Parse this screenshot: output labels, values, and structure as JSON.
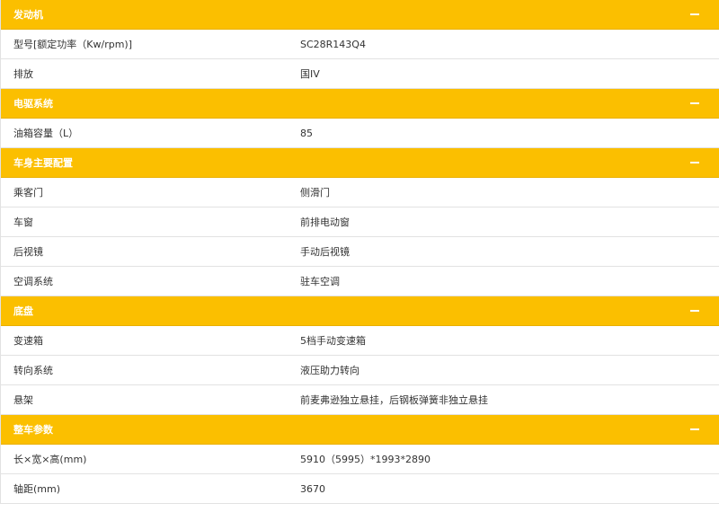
{
  "sections": [
    {
      "title": "发动机",
      "rows": [
        {
          "label": "型号[额定功率（Kw/rpm)]",
          "value": "SC28R143Q4"
        },
        {
          "label": "排放",
          "value": "国IV"
        }
      ]
    },
    {
      "title": "电驱系统",
      "rows": [
        {
          "label": "油箱容量（L）",
          "value": "85"
        }
      ]
    },
    {
      "title": "车身主要配置",
      "rows": [
        {
          "label": "乘客门",
          "value": "侧滑门"
        },
        {
          "label": "车窗",
          "value": "前排电动窗"
        },
        {
          "label": "后视镜",
          "value": "手动后视镜"
        },
        {
          "label": "空调系统",
          "value": "驻车空调"
        }
      ]
    },
    {
      "title": "底盘",
      "rows": [
        {
          "label": "变速箱",
          "value": "5档手动变速箱"
        },
        {
          "label": "转向系统",
          "value": "液压助力转向"
        },
        {
          "label": "悬架",
          "value": "前麦弗逊独立悬挂，后钢板弹簧非独立悬挂"
        }
      ]
    },
    {
      "title": "整车参数",
      "rows": [
        {
          "label": "长×宽×高(mm)",
          "value": "5910（5995）*1993*2890"
        },
        {
          "label": "轴距(mm)",
          "value": "3670"
        }
      ]
    }
  ],
  "icons": {
    "collapse": "minus-icon"
  },
  "colors": {
    "header_background": "#fbbf00",
    "header_text": "#ffffff",
    "row_text": "#333333",
    "divider": "#e2e2e2"
  }
}
